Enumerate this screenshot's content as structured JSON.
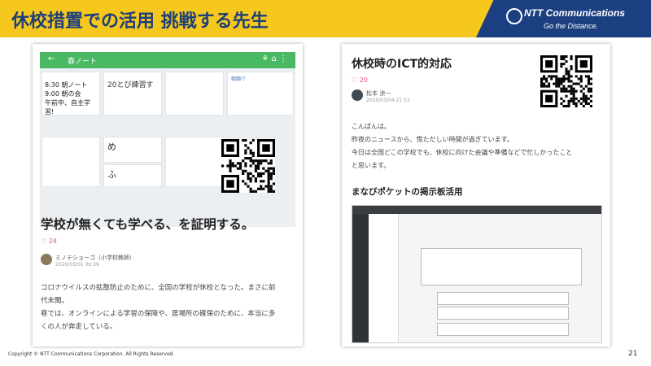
{
  "slide": {
    "title": "休校措置での活用 挑戦する先生",
    "page_number": "21",
    "copyright": "Copyright © NTT Communications Corporation. All Rights Reserved."
  },
  "logo": {
    "name": "NTT Communications",
    "tagline": "Go the Distance."
  },
  "left_card": {
    "appbar": {
      "back": "←",
      "title": "春ノート",
      "right_icons": "⚘ ⌂ ⋮"
    },
    "schedule": [
      "8:30 朝ノート",
      "9:00 朝の会",
      "午前中、自主学習!"
    ],
    "tiles": [
      "20とび練習す",
      "朝顔で",
      "め",
      "ふ"
    ],
    "title": "学校が無くても学べる、を証明する。",
    "likes": "24",
    "author": "ミノテショーゴ（小学校教師）",
    "date": "2020/03/01 09:39",
    "body": [
      "コロナウイルスの拡散防止のために、全国の学校が休校となった。まさに前",
      "代未聞。",
      "巷では、オンラインによる学習の保障や、居場所の確保のために、本当に多",
      "くの人が奔走している。"
    ]
  },
  "right_card": {
    "title": "休校時のICT的対応",
    "likes": "20",
    "author": "松本 涼一",
    "date": "2020/03/04 21:53",
    "body": [
      "こんばんは。",
      "昨夜のニュースから、慌ただしい時間が過ぎています。",
      "今日は全国どこの学校でも、休校に向けた会議や準備などで忙しかったこと",
      "と思います。"
    ],
    "subheading": "まなびポケットの掲示板活用"
  },
  "colors": {
    "banner": "#f6c81e",
    "title": "#1d3f7a",
    "logo_bg": "#1b3f80",
    "appbar": "#49b963",
    "like": "#e0566e"
  }
}
